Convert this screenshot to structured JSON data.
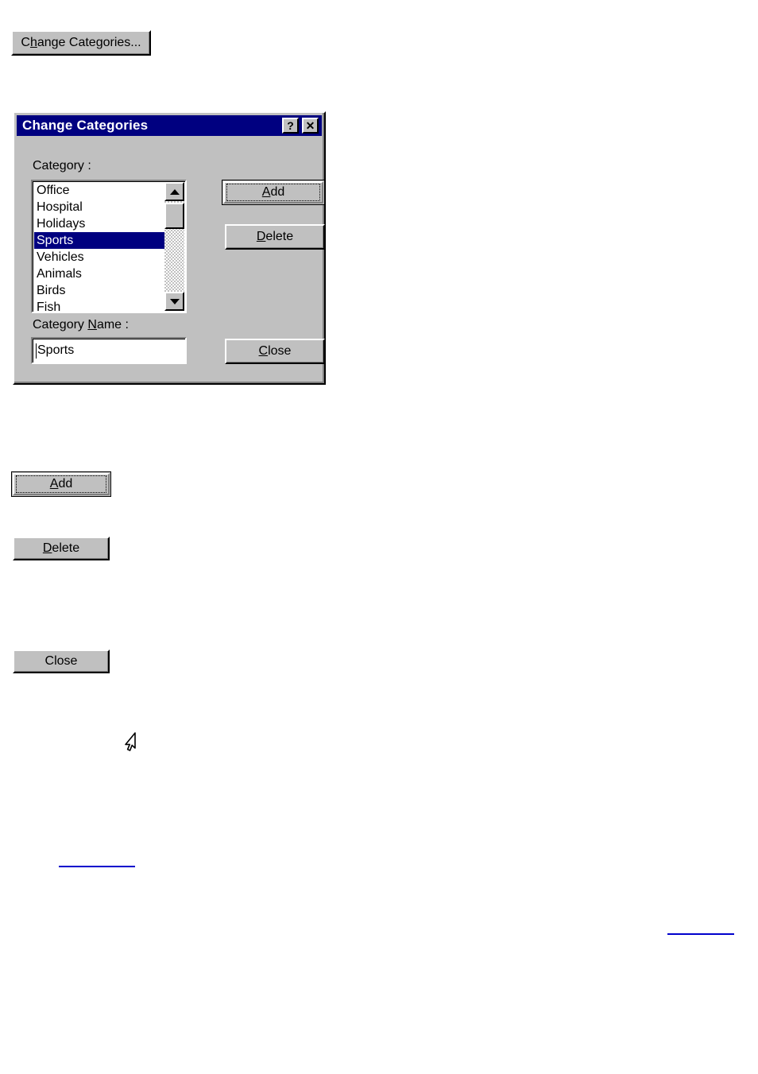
{
  "page": {
    "background_color": "#ffffff"
  },
  "top_button": {
    "name": "change-categories-button",
    "label_before_accel": "C",
    "accel": "h",
    "label_after_accel": "ange Categories...",
    "full_label": "Change Categories..."
  },
  "dialog": {
    "title": "Change Categories",
    "titlebar_color": "#000080",
    "face_color": "#c0c0c0",
    "title_buttons": {
      "help": "?",
      "close": "✕"
    },
    "category_label": "Category :",
    "category_name_label_before_accel": "Category ",
    "category_name_accel": "N",
    "category_name_label_after_accel": "ame :",
    "category_name_label_full": "Category Name :",
    "listbox": {
      "items": [
        {
          "label": "Office",
          "selected": false
        },
        {
          "label": "Hospital",
          "selected": false
        },
        {
          "label": "Holidays",
          "selected": false
        },
        {
          "label": "Sports",
          "selected": true
        },
        {
          "label": "Vehicles",
          "selected": false
        },
        {
          "label": "Animals",
          "selected": false
        },
        {
          "label": "Birds",
          "selected": false
        },
        {
          "label": "Fish",
          "selected": false
        }
      ],
      "selected_value": "Sports",
      "selection_color": "#000080",
      "selection_text_color": "#ffffff"
    },
    "category_name_input": {
      "value": "Sports",
      "placeholder": ""
    },
    "buttons": {
      "add": {
        "accel": "A",
        "rest": "dd",
        "full_label": "Add",
        "is_default": true
      },
      "delete": {
        "accel": "D",
        "rest": "elete",
        "full_label": "Delete",
        "is_default": false
      },
      "close": {
        "accel": "C",
        "rest": "lose",
        "full_label": "Close",
        "is_default": false
      }
    }
  },
  "standalone_buttons": {
    "add": {
      "accel": "A",
      "rest": "dd",
      "full_label": "Add",
      "is_default": true
    },
    "delete": {
      "accel": "D",
      "rest": "elete",
      "full_label": "Delete",
      "is_default": false
    },
    "close": {
      "accel": "",
      "rest": "Close",
      "full_label": "Close",
      "is_default": false
    }
  },
  "cursor": {
    "name": "mouse-pointer-arrow"
  },
  "links": {
    "previous": {
      "text": ""
    },
    "next": {
      "text": ""
    }
  }
}
